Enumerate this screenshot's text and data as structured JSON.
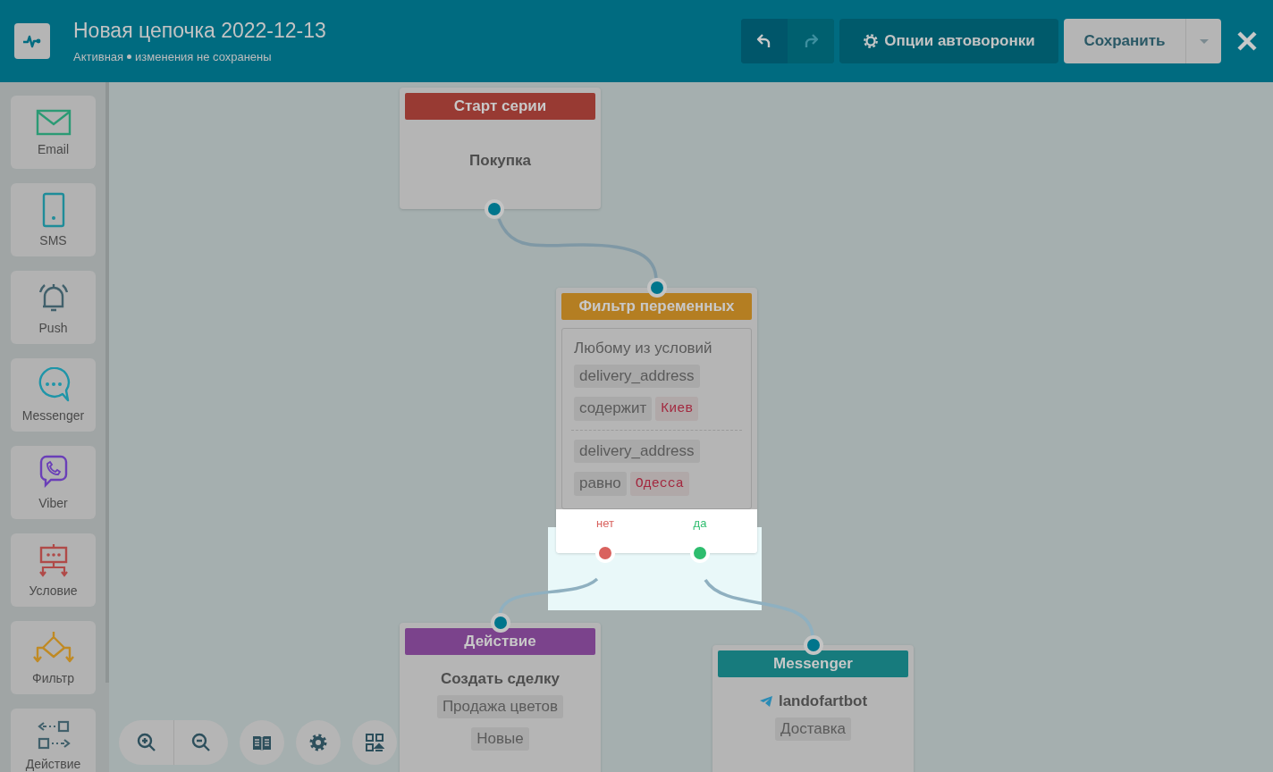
{
  "header": {
    "title": "Новая цепочка 2022-12-13",
    "status": "Активная",
    "changes": "изменения не сохранены",
    "history": [
      {
        "kind": "undo",
        "disabled": false
      },
      {
        "kind": "redo",
        "disabled": true
      }
    ],
    "options_button": "Опции автоворонки",
    "save_button": "Сохранить"
  },
  "sidebar": {
    "items": [
      {
        "kind": "email",
        "label": "Email"
      },
      {
        "kind": "sms",
        "label": "SMS"
      },
      {
        "kind": "push",
        "label": "Push"
      },
      {
        "kind": "messenger",
        "label": "Messenger"
      },
      {
        "kind": "viber",
        "label": "Viber"
      },
      {
        "kind": "condition",
        "label": "Условие"
      },
      {
        "kind": "filter",
        "label": "Фильтр"
      },
      {
        "kind": "action",
        "label": "Действие"
      }
    ]
  },
  "nodes": [
    {
      "kind": "start",
      "title": "Старт серии",
      "color": "#983a33",
      "text": "Покупка"
    },
    {
      "kind": "filter",
      "title": "Фильтр переменных",
      "color": "#b47e22",
      "mode": "Любому из условий",
      "conditions": [
        {
          "variable": "delivery_address",
          "operator": "содержит",
          "value": "Киев"
        },
        {
          "variable": "delivery_address",
          "operator": "равно",
          "value": "Одесса"
        }
      ],
      "outputs": [
        {
          "label": "нет",
          "color": "#d9625e"
        },
        {
          "label": "да",
          "color": "#2ebd6e"
        }
      ]
    },
    {
      "kind": "action",
      "title": "Действие",
      "color": "#7b438c",
      "text": "Создать сделку",
      "tags": [
        "Продажа цветов",
        "Новые"
      ]
    },
    {
      "kind": "messenger",
      "title": "Messenger",
      "color": "#177b7d",
      "text": "landofartbot",
      "tags": [
        "Доставка"
      ]
    }
  ]
}
